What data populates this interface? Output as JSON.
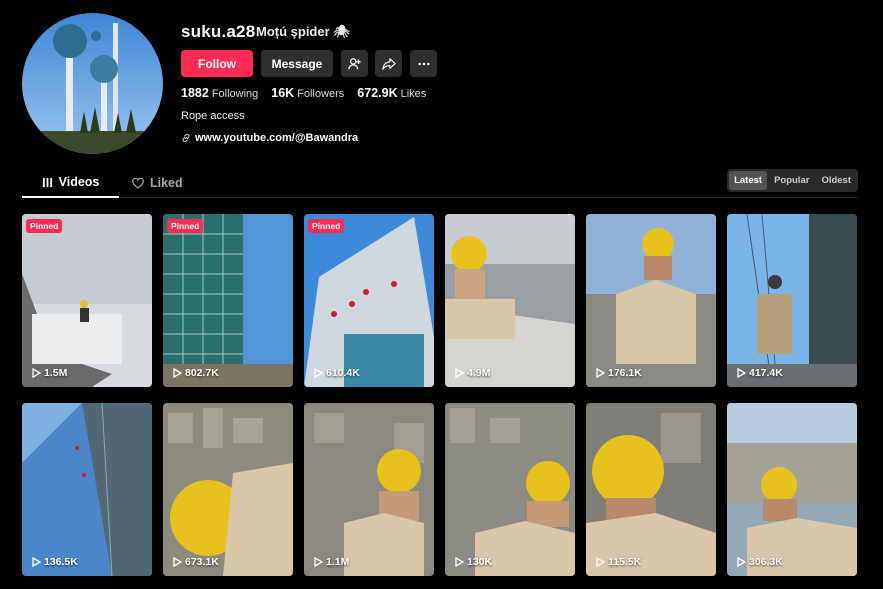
{
  "profile": {
    "username": "suku.a28",
    "nickname": "Moțú şpider 🕷",
    "bio": "Rope access",
    "link": "www.youtube.com/@Bawandra"
  },
  "actions": {
    "follow": "Follow",
    "message": "Message"
  },
  "stats": {
    "following_count": "1882",
    "following_label": "Following",
    "followers_count": "16K",
    "followers_label": "Followers",
    "likes_count": "672.9K",
    "likes_label": "Likes"
  },
  "tabs": {
    "videos": "Videos",
    "liked": "Liked"
  },
  "sort": {
    "latest": "Latest",
    "popular": "Popular",
    "oldest": "Oldest",
    "selected": "Latest"
  },
  "videos": [
    {
      "views": "1.5M",
      "pinned": "Pinned"
    },
    {
      "views": "802.7K",
      "pinned": "Pinned"
    },
    {
      "views": "610.4K",
      "pinned": "Pinned"
    },
    {
      "views": "4.9M"
    },
    {
      "views": "176.1K"
    },
    {
      "views": "417.4K"
    },
    {
      "views": "136.5K"
    },
    {
      "views": "673.1K"
    },
    {
      "views": "1.1M"
    },
    {
      "views": "130K"
    },
    {
      "views": "115.5K"
    },
    {
      "views": "306.3K"
    }
  ],
  "colors": {
    "accent": "#fe2c55",
    "background": "#000000",
    "button": "#2f2f2f"
  }
}
